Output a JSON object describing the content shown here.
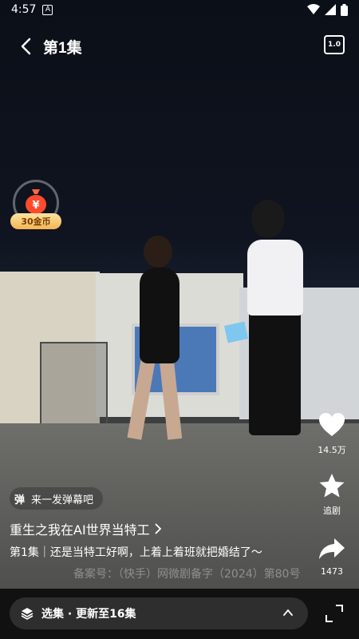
{
  "status_bar": {
    "time": "4:57",
    "notification_icon": "A"
  },
  "header": {
    "back_icon": "chevron-left",
    "title": "第1集",
    "speed_label": "1.0"
  },
  "coin_badge": {
    "label": "30金币"
  },
  "actions": {
    "like": {
      "icon": "heart",
      "label": "14.5万"
    },
    "follow": {
      "icon": "star",
      "label": "追剧"
    },
    "share": {
      "icon": "share-arrow",
      "label": "1473"
    }
  },
  "danmaku": {
    "icon_text": "弹",
    "placeholder": "来一发弹幕吧"
  },
  "drama": {
    "title": "重生之我在AI世界当特工",
    "description": "第1集｜还是当特工好啊，上着上着班就把婚结了～",
    "filing_watermark": "备案号：（快手）网微剧备字（2024）第80号"
  },
  "bottom_bar": {
    "episodes_label": "选集 · 更新至16集",
    "fullscreen_icon": "fullscreen"
  },
  "colors": {
    "background": "#000000",
    "pill_bg": "#2e2e2e",
    "coin_gold": "#f3b552"
  }
}
